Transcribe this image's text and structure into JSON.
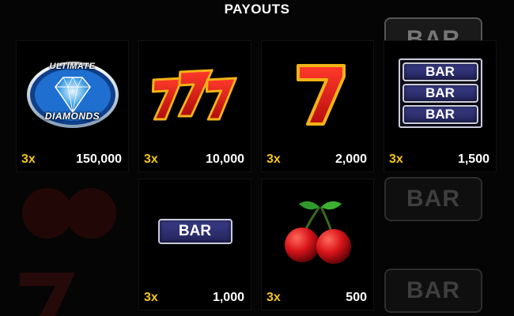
{
  "title": "PAYOUTS",
  "cards": [
    {
      "symbol": "ultimate-diamonds",
      "logo_line1": "ULTIMATE",
      "logo_line2": "DIAMONDS",
      "multiplier": "3x",
      "payout": "150,000"
    },
    {
      "symbol": "triple-seven",
      "multiplier": "3x",
      "payout": "10,000"
    },
    {
      "symbol": "single-seven",
      "multiplier": "3x",
      "payout": "2,000"
    },
    {
      "symbol": "triple-bar",
      "bar_label": "BAR",
      "multiplier": "3x",
      "payout": "1,500"
    },
    {
      "symbol": "single-bar",
      "bar_label": "BAR",
      "multiplier": "3x",
      "payout": "1,000"
    },
    {
      "symbol": "cherry",
      "multiplier": "3x",
      "payout": "500"
    }
  ],
  "background": {
    "bar_label": "BAR"
  },
  "colors": {
    "multiplier": "#f5c518",
    "text": "#ffffff",
    "card_bg": "#000000"
  }
}
